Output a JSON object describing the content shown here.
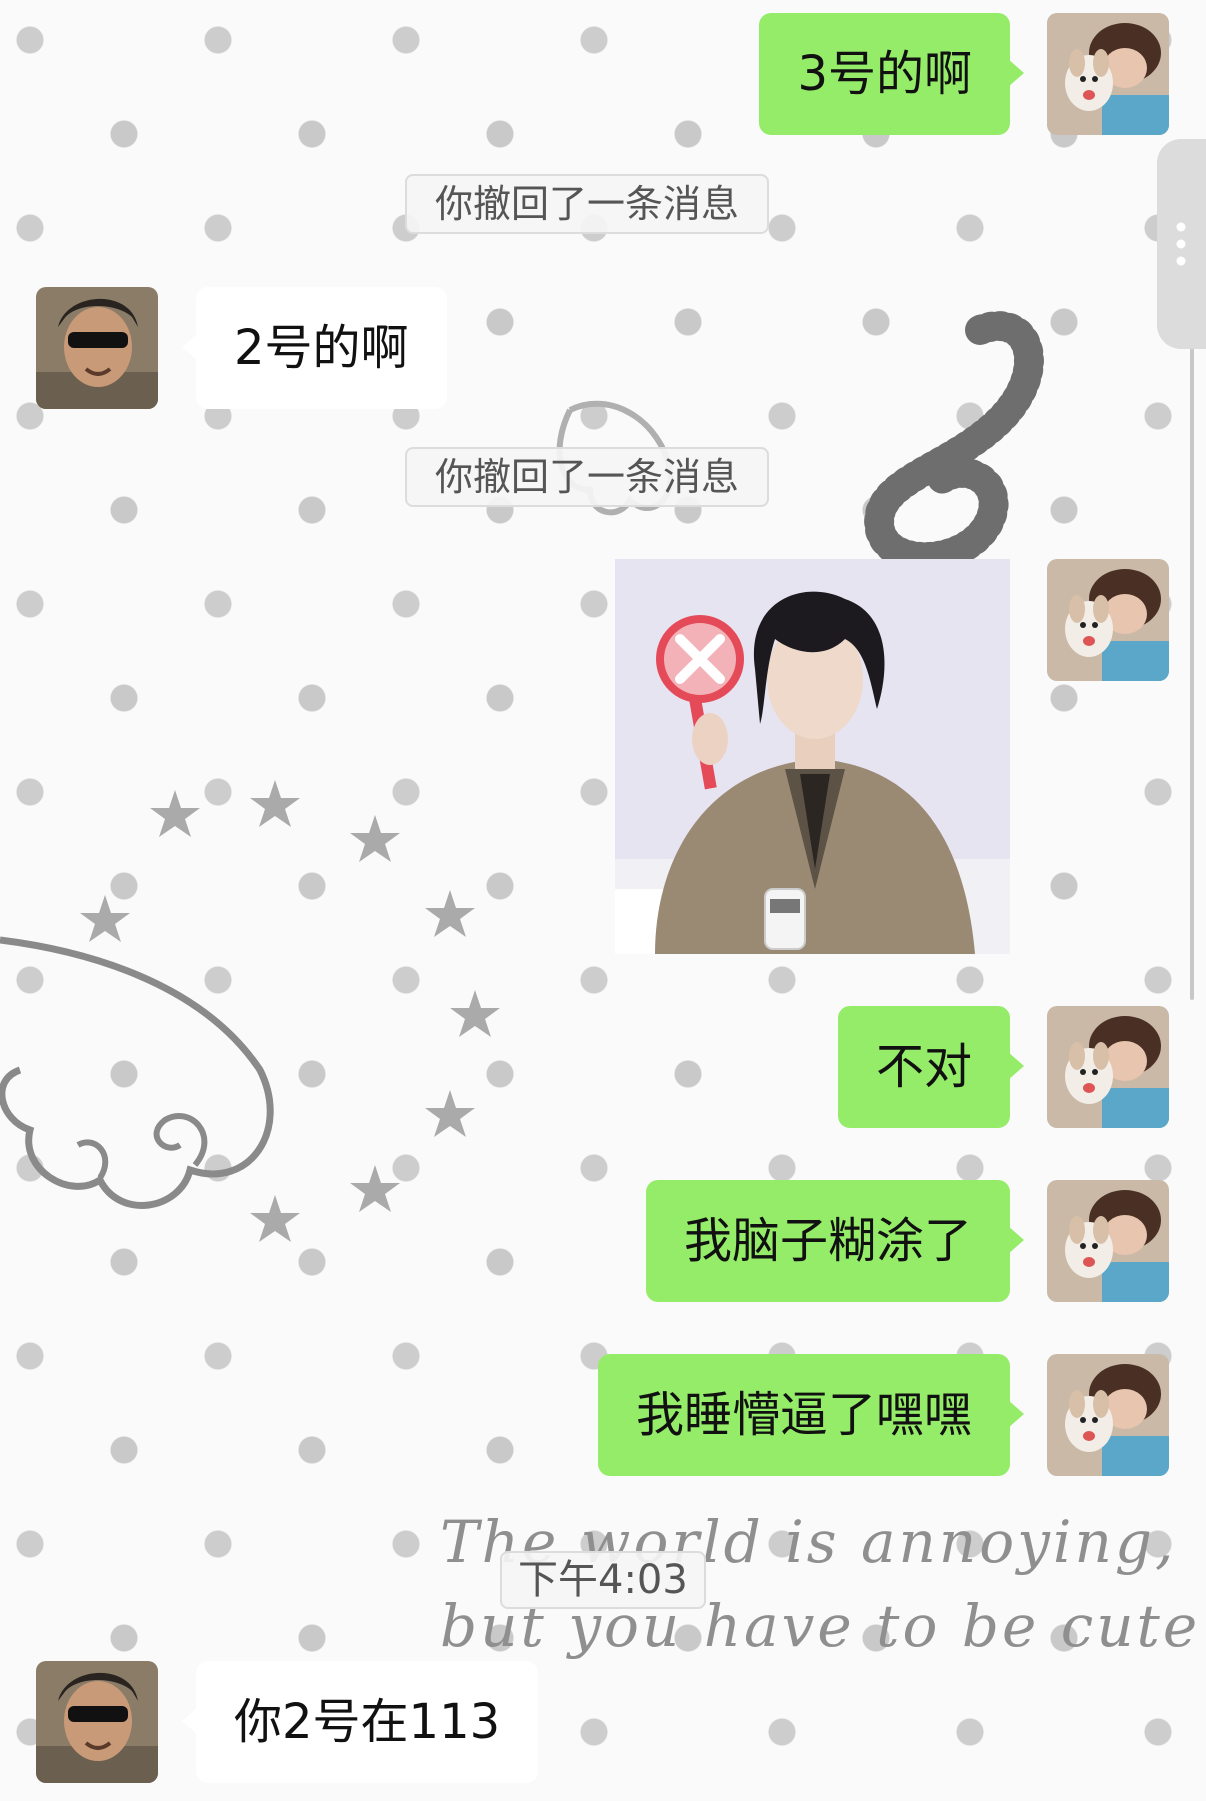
{
  "messages": [
    {
      "side": "me",
      "text": "3号的啊"
    },
    {
      "type": "system",
      "text": "你撤回了一条消息"
    },
    {
      "side": "them",
      "text": "2号的啊"
    },
    {
      "type": "system",
      "text": "你撤回了一条消息"
    },
    {
      "side": "me",
      "type": "image",
      "alt": "sticker: man in suit holding red X sign"
    },
    {
      "side": "me",
      "text": "不对"
    },
    {
      "side": "me",
      "text": "我脑子糊涂了"
    },
    {
      "side": "me",
      "text": "我睡懵逼了嘿嘿"
    },
    {
      "type": "time",
      "text": "下午4:03"
    },
    {
      "side": "them",
      "text": "你2号在113"
    }
  ],
  "wallpaper": {
    "line1": "The world is annoying,",
    "line2": "but you have to be cute"
  },
  "colors": {
    "my_bubble": "#95ec69",
    "their_bubble": "#ffffff",
    "background": "#fafafa"
  },
  "icons": {
    "scroll_handle": "more-vertical-icon"
  }
}
